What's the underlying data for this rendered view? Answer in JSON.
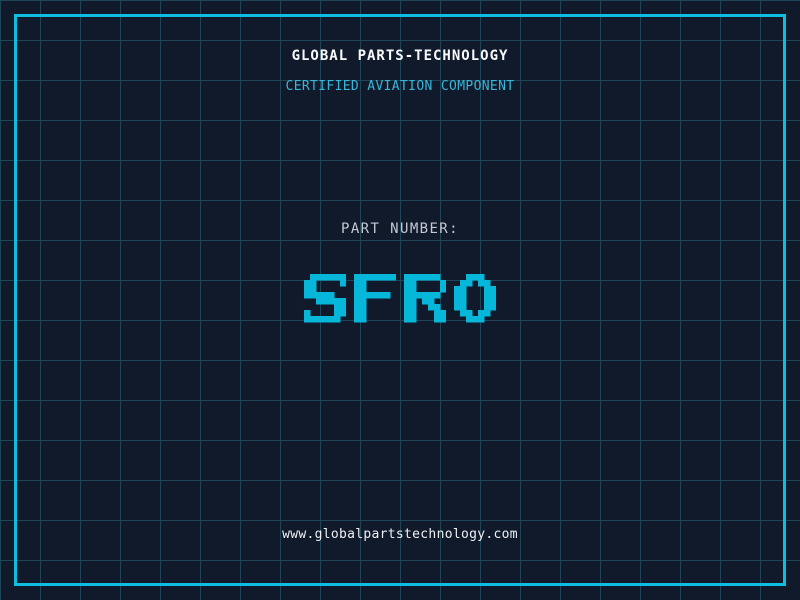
{
  "header": {
    "company_name": "GLOBAL PARTS-TECHNOLOGY",
    "certification_line": "CERTIFIED AVIATION COMPONENT"
  },
  "part": {
    "label": "PART NUMBER:",
    "number": "SFRO"
  },
  "footer": {
    "website_url": "www.globalpartstechnology.com"
  },
  "colors": {
    "background": "#111a2b",
    "grid_line": "#1e4658",
    "frame_border": "#0ebee0",
    "company_name_text": "#f8fafc",
    "certification_text": "#3ab5d8",
    "part_label_text": "#c3c9d4",
    "part_number_text": "#06b7d9",
    "website_text": "#eef1f5"
  }
}
